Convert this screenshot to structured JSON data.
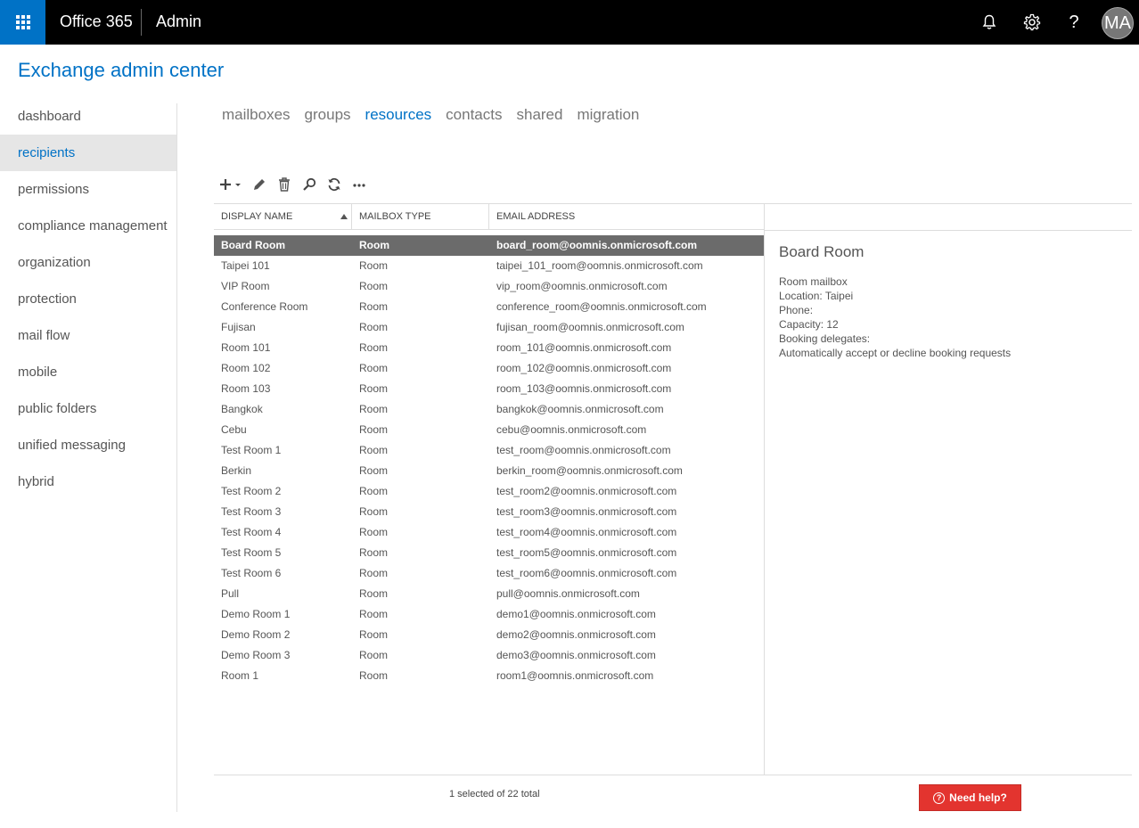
{
  "topbar": {
    "brand": "Office 365",
    "app": "Admin",
    "avatar_initials": "MA"
  },
  "page_title": "Exchange admin center",
  "sidebar": {
    "items": [
      {
        "label": "dashboard"
      },
      {
        "label": "recipients",
        "active": true
      },
      {
        "label": "permissions"
      },
      {
        "label": "compliance management"
      },
      {
        "label": "organization"
      },
      {
        "label": "protection"
      },
      {
        "label": "mail flow"
      },
      {
        "label": "mobile"
      },
      {
        "label": "public folders"
      },
      {
        "label": "unified messaging"
      },
      {
        "label": "hybrid"
      }
    ]
  },
  "tabs": [
    {
      "label": "mailboxes"
    },
    {
      "label": "groups"
    },
    {
      "label": "resources",
      "active": true
    },
    {
      "label": "contacts"
    },
    {
      "label": "shared"
    },
    {
      "label": "migration"
    }
  ],
  "table": {
    "headers": [
      "DISPLAY NAME",
      "MAILBOX TYPE",
      "EMAIL ADDRESS"
    ],
    "rows": [
      [
        "Board Room",
        "Room",
        "board_room@oomnis.onmicrosoft.com"
      ],
      [
        "Taipei 101",
        "Room",
        "taipei_101_room@oomnis.onmicrosoft.com"
      ],
      [
        "VIP Room",
        "Room",
        "vip_room@oomnis.onmicrosoft.com"
      ],
      [
        "Conference Room",
        "Room",
        "conference_room@oomnis.onmicrosoft.com"
      ],
      [
        "Fujisan",
        "Room",
        "fujisan_room@oomnis.onmicrosoft.com"
      ],
      [
        "Room 101",
        "Room",
        "room_101@oomnis.onmicrosoft.com"
      ],
      [
        "Room 102",
        "Room",
        "room_102@oomnis.onmicrosoft.com"
      ],
      [
        "Room 103",
        "Room",
        "room_103@oomnis.onmicrosoft.com"
      ],
      [
        "Bangkok",
        "Room",
        "bangkok@oomnis.onmicrosoft.com"
      ],
      [
        "Cebu",
        "Room",
        "cebu@oomnis.onmicrosoft.com"
      ],
      [
        "Test Room 1",
        "Room",
        "test_room@oomnis.onmicrosoft.com"
      ],
      [
        "Berkin",
        "Room",
        "berkin_room@oomnis.onmicrosoft.com"
      ],
      [
        "Test Room 2",
        "Room",
        "test_room2@oomnis.onmicrosoft.com"
      ],
      [
        "Test Room 3",
        "Room",
        "test_room3@oomnis.onmicrosoft.com"
      ],
      [
        "Test Room 4",
        "Room",
        "test_room4@oomnis.onmicrosoft.com"
      ],
      [
        "Test Room 5",
        "Room",
        "test_room5@oomnis.onmicrosoft.com"
      ],
      [
        "Test Room 6",
        "Room",
        "test_room6@oomnis.onmicrosoft.com"
      ],
      [
        "Pull",
        "Room",
        "pull@oomnis.onmicrosoft.com"
      ],
      [
        "Demo Room 1",
        "Room",
        "demo1@oomnis.onmicrosoft.com"
      ],
      [
        "Demo Room 2",
        "Room",
        "demo2@oomnis.onmicrosoft.com"
      ],
      [
        "Demo Room 3",
        "Room",
        "demo3@oomnis.onmicrosoft.com"
      ],
      [
        "Room 1",
        "Room",
        "room1@oomnis.onmicrosoft.com"
      ]
    ],
    "selected_index": 0
  },
  "details": {
    "title": "Board Room",
    "lines": [
      "Room mailbox",
      "Location: Taipei",
      "Phone:",
      "Capacity: 12",
      "Booking delegates:",
      "Automatically accept or decline booking requests"
    ]
  },
  "status": "1 selected of 22 total",
  "help_label": "Need help?",
  "colors": {
    "accent": "#0072c6",
    "topbar": "#000000",
    "selected_row": "#6b6b6b",
    "help_button": "#e3342f"
  }
}
